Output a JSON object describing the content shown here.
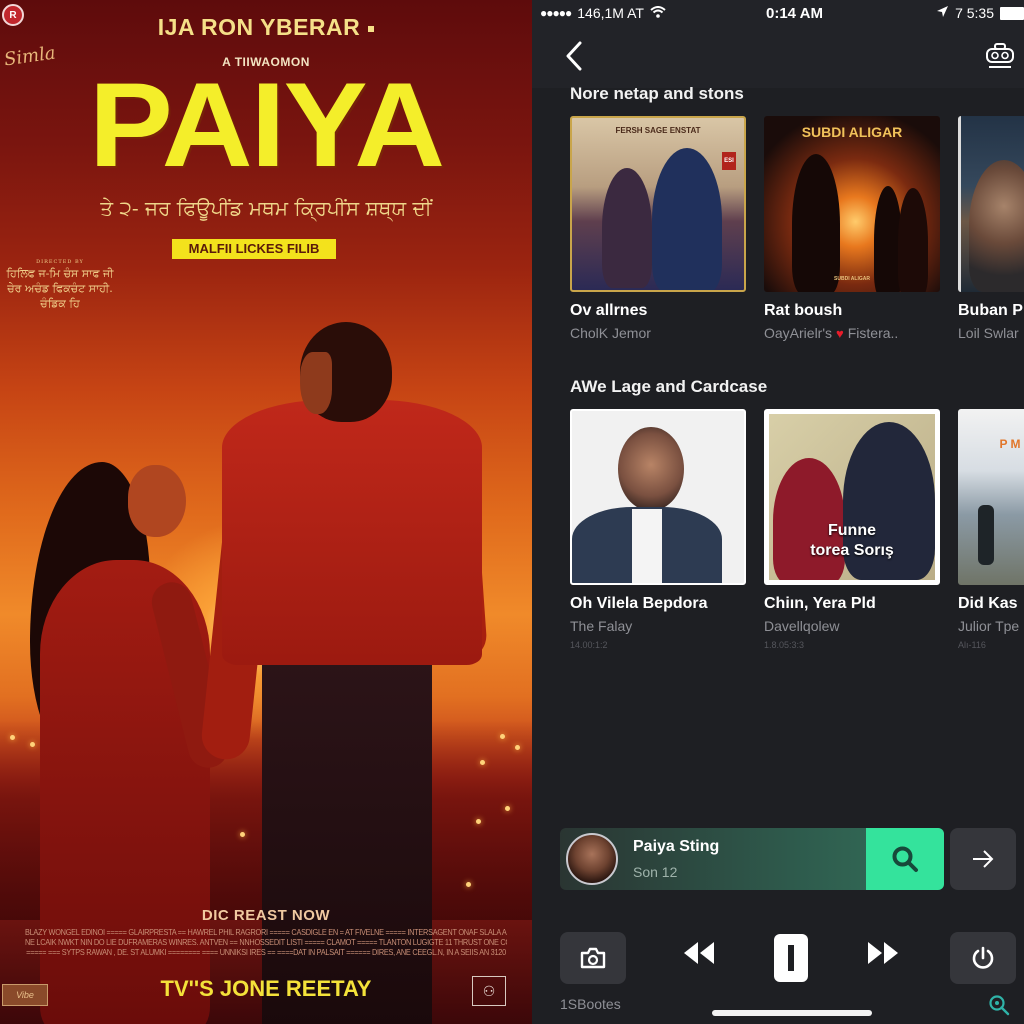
{
  "poster": {
    "studio_logo": "R",
    "signature": "Simla",
    "top_line": "IJA RON YBERAR",
    "presents": "A TIIWAOMON",
    "title": "PAIYA",
    "tagline_script": "ਤੇ ੨- ਜਰ ਫਿਊਪੀਂਡ ਮਥਮ ਕ੍ਰਿਪੀਂਸ ਸ਼ਥ੍ਯ ਦੀਂ",
    "banner": "MALFII LICKES FILIB",
    "side_credits": {
      "tiny": "DIRECTED BY",
      "lines": [
        "ਹਿਲਿਫ ਜ-ਮਿ ਚੰਸ ਸਾਫ ਜੀ",
        "ਚੇਰ ਅਚੰਡ ਫਿਕਚੰਟ ਸਾਹੀ.",
        "ਚੰਡਿਕ ਹਿ"
      ]
    },
    "cta": "DIC REAST NOW",
    "credit_lines": [
      "BLAZY WONGEL EDINOI ===== GLAIRPRESTA == HAWREL PHIL RAGRORI ===== CASDIGLE EN = AT FIVELNE ===== INTERSAGENT ONAF SLALA A.NILE ZALONA",
      "NE LCAIK NWKT NIN DO LIE DUFRAMERAS WINRES. ANTVEN == NNHOSSEDIT LISTI ===== CLAMOT ===== TLANTON LUGIGTE 11 THRUST ONE COLMK",
      "===== === SYTPS RAWAN , DE. ST ALUMKI ======== ==== UNNIKSI IRES == ====DAT IN PALSAIT ====== DIRES, ANE CEEGL.N, IN A SEIIS AN 3120"
    ],
    "release_line": "TV''S JONE REETAY",
    "corner_logo_left": "Vibe",
    "corner_logo_right": "⚇"
  },
  "status_bar": {
    "signal_dots": "●●●●●",
    "carrier": "146,1M AT",
    "time": "0:14 AM",
    "right_text": "7 5:35"
  },
  "nav": {
    "back_icon": "‹",
    "cast_icon": "cast-icon"
  },
  "sections": [
    {
      "title": "Nore netap and stons",
      "cards": [
        {
          "title": "Ov allrnes",
          "subtitle": "CholK Jemor",
          "art_text": "FERSH SAGE ENSTAT",
          "art_badge": "ESI"
        },
        {
          "title": "Rat boush",
          "subtitle_a": "OayArielr's",
          "subtitle_b": "Fistera..",
          "art_text": "SUBDI ALIGAR",
          "art_caption": "SUBDI ALIGAR"
        },
        {
          "title": "Buban P",
          "subtitle": "Loil Swlar"
        }
      ]
    },
    {
      "title": "AWe Lage and Cardcase",
      "cards": [
        {
          "title": "Oh Vilela Bepdora",
          "subtitle": "The Falay",
          "meta": "14.00:1:2"
        },
        {
          "title": "Chiın, Yera Pld",
          "subtitle": "Davellqolew",
          "meta": "1.8.05:3:3",
          "art_text_1": "Funne",
          "art_text_2": "torea Sorış"
        },
        {
          "title": "Did Kas",
          "subtitle": "Julior Tpe",
          "meta": "Alı-116",
          "art_text": "P M"
        }
      ]
    }
  ],
  "now_playing": {
    "title": "Paiya Sting",
    "subtitle": "Son 12"
  },
  "controls": {
    "bottom_label": "1SBootes"
  },
  "colors": {
    "accent_green": "#34e39c",
    "app_bg": "#1e1f23",
    "title_yellow": "#f4ee2a",
    "heart_red": "#e81c2a"
  }
}
